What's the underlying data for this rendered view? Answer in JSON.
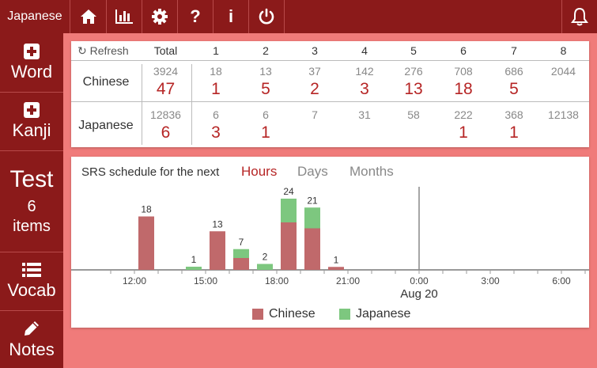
{
  "topbar": {
    "language": "Japanese",
    "icons": [
      "home-icon",
      "stats-icon",
      "settings-icon",
      "help-icon",
      "info-icon",
      "power-icon"
    ],
    "glyphs": {
      "help": "?",
      "info": "i"
    }
  },
  "sidebar": {
    "word": "Word",
    "kanji": "Kanji",
    "test": {
      "title": "Test",
      "count": "6",
      "unit": "items"
    },
    "vocab": "Vocab",
    "notes": "Notes"
  },
  "stats": {
    "refresh_label": "Refresh",
    "total_label": "Total",
    "levels": [
      "1",
      "2",
      "3",
      "4",
      "5",
      "6",
      "7",
      "8"
    ],
    "rows": [
      {
        "label": "Chinese",
        "total": "3924",
        "total_due": "47",
        "counts": [
          "18",
          "13",
          "37",
          "142",
          "276",
          "708",
          "686",
          "2044"
        ],
        "due": [
          "1",
          "5",
          "2",
          "3",
          "13",
          "18",
          "5",
          ""
        ]
      },
      {
        "label": "Japanese",
        "total": "12836",
        "total_due": "6",
        "counts": [
          "6",
          "6",
          "7",
          "31",
          "58",
          "222",
          "368",
          "12138"
        ],
        "due": [
          "3",
          "1",
          "",
          "",
          "",
          "1",
          "1",
          ""
        ]
      }
    ]
  },
  "schedule": {
    "title": "SRS schedule for the next",
    "tabs": [
      "Hours",
      "Days",
      "Months"
    ],
    "active_tab": "Hours",
    "colors": {
      "chinese": "#c0696b",
      "japanese": "#7dc77f",
      "accent": "#b62525"
    }
  },
  "chart_data": {
    "type": "bar",
    "stacked": true,
    "x_ticks": [
      "12:00",
      "15:00",
      "18:00",
      "21:00",
      "0:00",
      "3:00",
      "6:00"
    ],
    "x_secondary_label": "Aug 20",
    "hour_offsets": [
      1,
      3,
      4,
      5,
      6,
      7,
      8,
      9,
      10,
      20
    ],
    "series": [
      {
        "name": "Chinese",
        "values": [
          18,
          0,
          13,
          4,
          0,
          16,
          14,
          1,
          0,
          1
        ]
      },
      {
        "name": "Japanese",
        "values": [
          0,
          1,
          0,
          3,
          2,
          8,
          7,
          0,
          0,
          0
        ]
      }
    ],
    "totals": [
      18,
      1,
      13,
      7,
      2,
      24,
      21,
      1,
      0,
      1
    ],
    "legend_position": "bottom"
  }
}
